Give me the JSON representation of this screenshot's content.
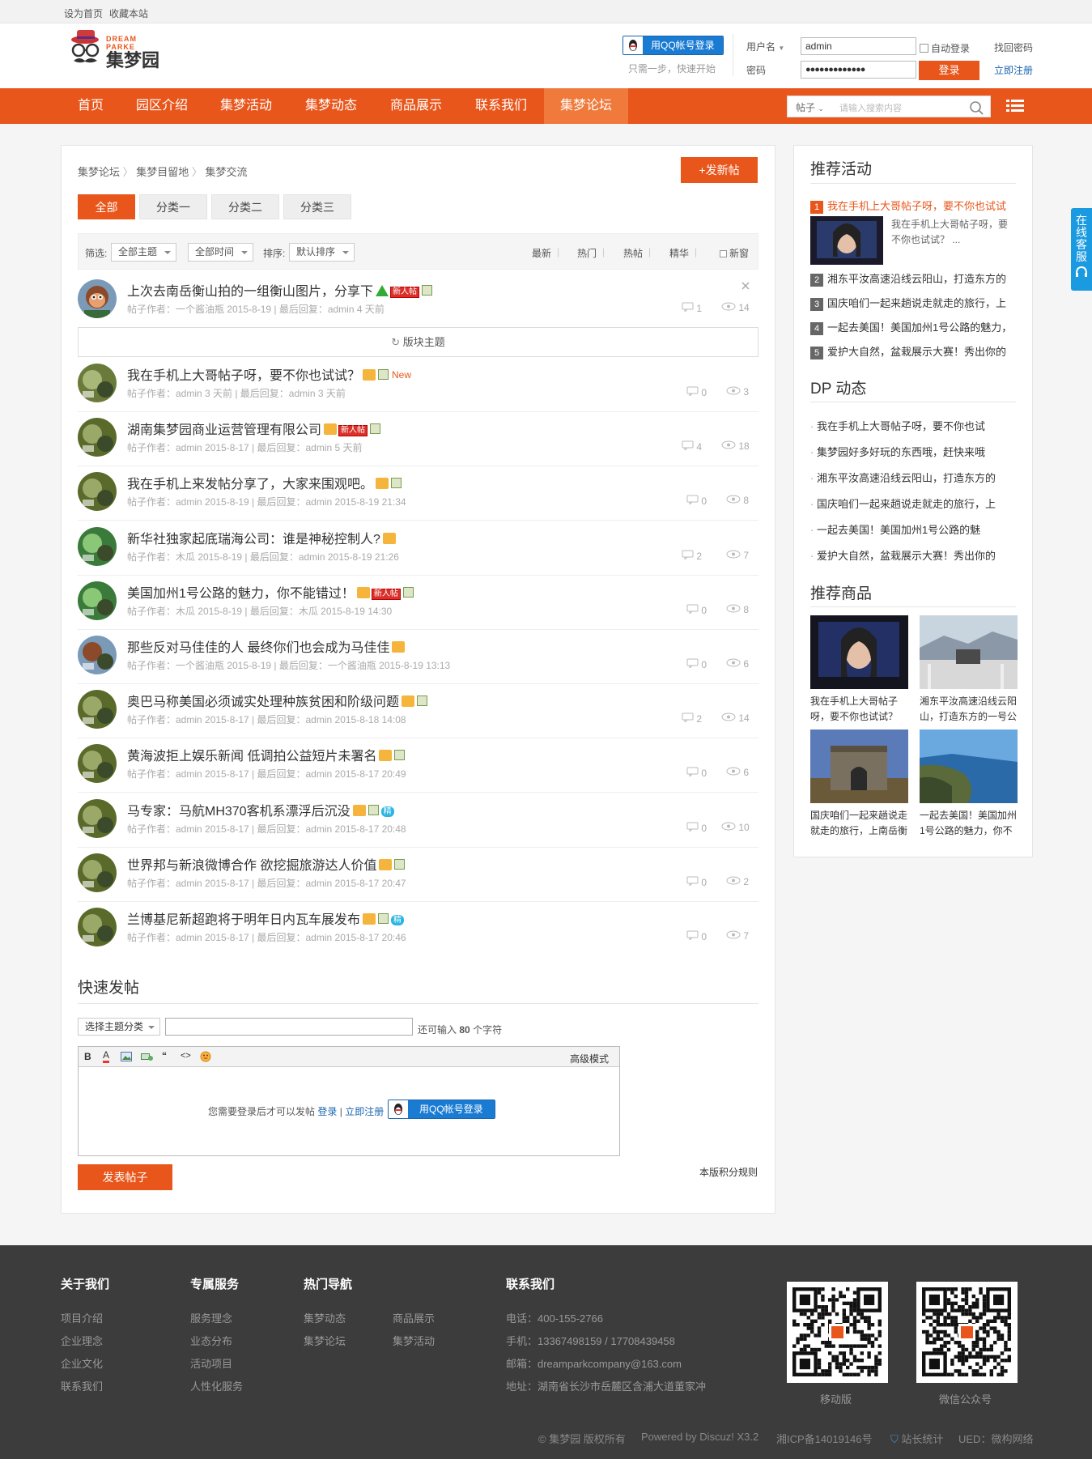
{
  "topbar": {
    "sethome": "设为首页",
    "fav": "收藏本站"
  },
  "header": {
    "logo_en": "DREAM PARKE",
    "logo_cn": "集梦园",
    "qq_login": "用QQ帐号登录",
    "qq_tip": "只需一步，快速开始",
    "user_label": "用户名",
    "user_value": "admin",
    "pass_label": "密码",
    "pass_value": "●●●●●●●●●●●●●",
    "auto_login": "自动登录",
    "find_pwd": "找回密码",
    "login_btn": "登录",
    "register": "立即注册"
  },
  "nav": {
    "items": [
      "首页",
      "园区介绍",
      "集梦活动",
      "集梦动态",
      "商品展示",
      "联系我们",
      "集梦论坛"
    ],
    "search_type": "帖子",
    "search_placeholder": "请输入搜索内容"
  },
  "forum": {
    "breadcrumb": [
      "集梦论坛",
      "集梦目留地",
      "集梦交流"
    ],
    "new_post": "+发新帖",
    "tabs": [
      "全部",
      "分类一",
      "分类二",
      "分类三"
    ],
    "filter_label": "筛选:",
    "filter_theme": "全部主题",
    "filter_time": "全部时间",
    "sort_label": "排序:",
    "sort_default": "默认排序",
    "sorts": [
      "最新",
      "热门",
      "热帖",
      "精华"
    ],
    "new_window": "新窗",
    "block_topics": "版块主题",
    "pinned": {
      "title": "上次去南岳衡山拍的一组衡山图片，分享下",
      "newtag": "新人帖",
      "meta": "帖子作者：一个酱油瓶  2015-8-19   |   最后回复：admin 4 天前",
      "replies": "1",
      "views": "14"
    },
    "threads": [
      {
        "title": "我在手机上大哥帖子呀，要不你也试试？",
        "tag": "New",
        "meta": "帖子作者：admin 3 天前   |   最后回复：admin 3 天前",
        "replies": "0",
        "views": "3"
      },
      {
        "title": "湖南集梦园商业运营管理有限公司",
        "tag": "新人帖",
        "meta": "帖子作者：admin 2015-8-17   |   最后回复：admin 5 天前",
        "replies": "4",
        "views": "18"
      },
      {
        "title": "我在手机上来发帖分享了，大家来围观吧。",
        "tag": "",
        "meta": "帖子作者：admin 2015-8-19   |   最后回复：admin 2015-8-19 21:34",
        "replies": "0",
        "views": "8"
      },
      {
        "title": "新华社独家起底瑞海公司：谁是神秘控制人?",
        "tag": "",
        "meta": "帖子作者：木瓜 2015-8-19   |   最后回复：admin 2015-8-19 21:26",
        "replies": "2",
        "views": "7"
      },
      {
        "title": "美国加州1号公路的魅力，你不能错过！",
        "tag": "新人帖",
        "meta": "帖子作者：木瓜 2015-8-19   |   最后回复：木瓜 2015-8-19 14:30",
        "replies": "0",
        "views": "8"
      },
      {
        "title": "那些反对马佳佳的人 最终你们也会成为马佳佳",
        "tag": "",
        "meta": "帖子作者：一个酱油瓶 2015-8-19   |   最后回复：一个酱油瓶 2015-8-19 13:13",
        "replies": "0",
        "views": "6"
      },
      {
        "title": "奥巴马称美国必须诚实处理种族贫困和阶级问题",
        "tag": "",
        "meta": "帖子作者：admin 2015-8-17   |   最后回复：admin 2015-8-18 14:08",
        "replies": "2",
        "views": "14"
      },
      {
        "title": "黄海波拒上娱乐新闻 低调拍公益短片未署名",
        "tag": "",
        "meta": "帖子作者：admin 2015-8-17   |   最后回复：admin 2015-8-17 20:49",
        "replies": "0",
        "views": "6"
      },
      {
        "title": "马专家：马航MH370客机系漂浮后沉没",
        "tag": "精",
        "meta": "帖子作者：admin 2015-8-17   |   最后回复：admin 2015-8-17 20:48",
        "replies": "0",
        "views": "10"
      },
      {
        "title": "世界邦与新浪微博合作 欲挖掘旅游达人价值",
        "tag": "",
        "meta": "帖子作者：admin 2015-8-17   |   最后回复：admin 2015-8-17 20:47",
        "replies": "0",
        "views": "2"
      },
      {
        "title": "兰博基尼新超跑将于明年日内瓦车展发布",
        "tag": "精",
        "meta": "帖子作者：admin 2015-8-17   |   最后回复：admin 2015-8-17 20:46",
        "replies": "0",
        "views": "7"
      }
    ]
  },
  "quickpost": {
    "title": "快速发帖",
    "select": "选择主题分类",
    "remain_pre": "还可输入",
    "remain_num": "80",
    "remain_post": "个字符",
    "advanced": "高级模式",
    "need_login": "您需要登录后才可以发帖",
    "login": "登录",
    "sep": "|",
    "register": "立即注册",
    "qq": "用QQ帐号登录",
    "submit": "发表帖子",
    "rules": "本版积分规则"
  },
  "side": {
    "rec_title": "推荐活动",
    "rec_first": "我在手机上大哥帖子呀，要不你也试试",
    "rec_first_desc": "我在手机上大哥帖子呀，要不你也试试？ ...",
    "rec_items": [
      "湘东平汝高速沿线云阳山，打造东方的",
      "国庆咱们一起来趟说走就走的旅行，上",
      "一起去美国！美国加州1号公路的魅力，",
      "爱护大自然，盆栽展示大赛！秀出你的"
    ],
    "dp_title": "DP 动态",
    "dp_items": [
      "我在手机上大哥帖子呀，要不你也试",
      "集梦园好多好玩的东西哦，赶快来哦",
      "湘东平汝高速沿线云阳山，打造东方的",
      "国庆咱们一起来趟说走就走的旅行，上",
      "一起去美国！美国加州1号公路的魅",
      "爱护大自然，盆栽展示大赛！秀出你的"
    ],
    "goods_title": "推荐商品",
    "goods": [
      "我在手机上大哥帖子呀，要不你也试试？",
      "湘东平汝高速沿线云阳山，打造东方的一号公",
      "国庆咱们一起来趟说走就走的旅行，上南岳衡",
      "一起去美国！美国加州1号公路的魅力，你不"
    ],
    "kefu": "在线客服"
  },
  "footer": {
    "about_title": "关于我们",
    "about": [
      "项目介绍",
      "企业理念",
      "企业文化",
      "联系我们"
    ],
    "service_title": "专属服务",
    "service": [
      "服务理念",
      "业态分布",
      "活动项目",
      "人性化服务"
    ],
    "hot_title": "热门导航",
    "hot": [
      "集梦动态",
      "商品展示",
      "集梦论坛",
      "集梦活动"
    ],
    "contact_title": "联系我们",
    "contact": [
      "电话：400-155-2766",
      "手机：13367498159 / 17708439458",
      "邮箱：dreamparkcompany@163.com",
      "地址：湖南省长沙市岳麓区含浦大道董家冲"
    ],
    "qr1": "移动版",
    "qr2": "微信公众号",
    "copyright": "© 集梦园 版权所有",
    "powered": "Powered by Discuz! X3.2",
    "icp": "湘ICP备14019146号",
    "stats": "站长统计",
    "ued": "UED：微构网络"
  }
}
